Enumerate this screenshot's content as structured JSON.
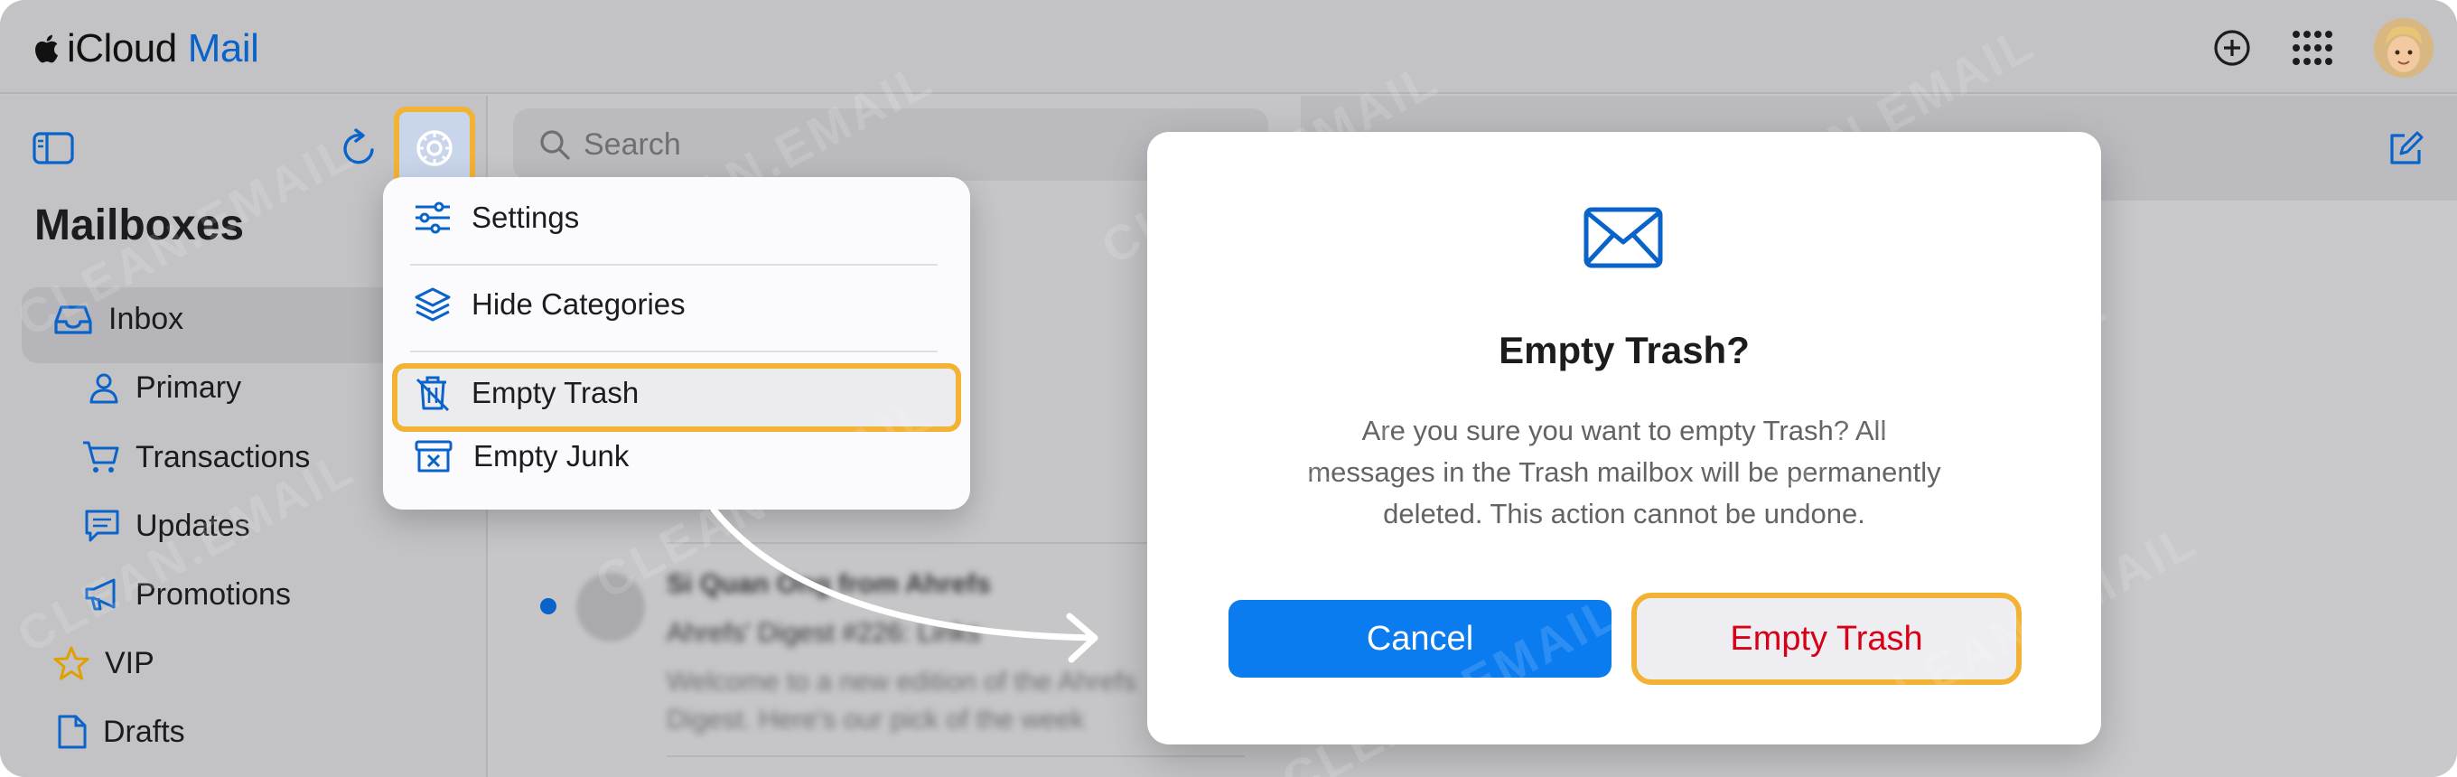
{
  "app": {
    "brand_prefix": "iCloud",
    "brand_suffix": "Mail"
  },
  "colors": {
    "accent_blue": "#0a7cf0",
    "highlight": "#f2b233",
    "destructive_red": "#d70015"
  },
  "sidebar": {
    "title": "Mailboxes",
    "items": [
      {
        "label": "Inbox",
        "icon": "tray-icon"
      },
      {
        "label": "Primary",
        "icon": "person-icon"
      },
      {
        "label": "Transactions",
        "icon": "cart-icon"
      },
      {
        "label": "Updates",
        "icon": "message-icon"
      },
      {
        "label": "Promotions",
        "icon": "megaphone-icon"
      },
      {
        "label": "VIP",
        "icon": "star-icon"
      },
      {
        "label": "Drafts",
        "icon": "document-icon"
      }
    ]
  },
  "search": {
    "placeholder": "Search"
  },
  "menu": {
    "items": [
      {
        "label": "Settings",
        "icon": "sliders-icon"
      },
      {
        "label": "Hide Categories",
        "icon": "layers-icon"
      },
      {
        "label": "Empty Trash",
        "icon": "trash-icon"
      },
      {
        "label": "Empty Junk",
        "icon": "junk-icon"
      }
    ]
  },
  "message_list": {
    "blurred_sender": "Si Quan Ong from Ahrefs",
    "blurred_subject": "Ahrefs' Digest #226: Links",
    "blurred_preview_1": "Welcome to a new edition of the Ahrefs",
    "blurred_preview_2": "Digest. Here's our pick of the week"
  },
  "dialog": {
    "title": "Empty Trash?",
    "body_line1": "Are you sure you want to empty Trash? All",
    "body_line2": "messages in the Trash mailbox will be permanently",
    "body_line3": "deleted. This action cannot be undone.",
    "cancel_label": "Cancel",
    "confirm_label": "Empty Trash"
  },
  "watermark": "CLEAN.EMAIL"
}
